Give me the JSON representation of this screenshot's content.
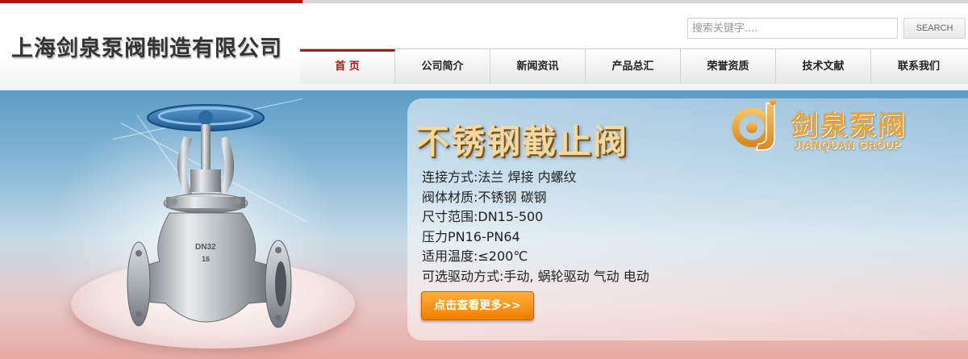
{
  "header": {
    "company_name": "上海剑泉泵阀制造有限公司",
    "search": {
      "placeholder": "搜索关键字....",
      "button_label": "SEARCH"
    }
  },
  "nav": {
    "items": [
      {
        "label": "首 页",
        "active": true
      },
      {
        "label": "公司简介",
        "active": false
      },
      {
        "label": "新闻资讯",
        "active": false
      },
      {
        "label": "产品总汇",
        "active": false
      },
      {
        "label": "荣誉资质",
        "active": false
      },
      {
        "label": "技术文献",
        "active": false
      },
      {
        "label": "联系我们",
        "active": false
      }
    ]
  },
  "banner": {
    "product_title": "不锈钢截止阀",
    "specs": [
      "连接方式:法兰 焊接 内螺纹",
      "阀体材质:不锈钢 碳钢",
      "尺寸范围:DN15-500",
      "压力PN16-PN64",
      "适用温度:≤200℃",
      "可选驱动方式:手动, 蜗轮驱动 气动 电动"
    ],
    "more_button": "点击查看更多>>",
    "brand_cn": "剑泉泵阀",
    "brand_en": "JIANQUAN GROUP",
    "valve_marking_1": "DN32",
    "valve_marking_2": "16"
  },
  "colors": {
    "accent_red": "#c40e0e",
    "button_orange": "#f07d00",
    "brand_gold": "#e9a53a"
  }
}
